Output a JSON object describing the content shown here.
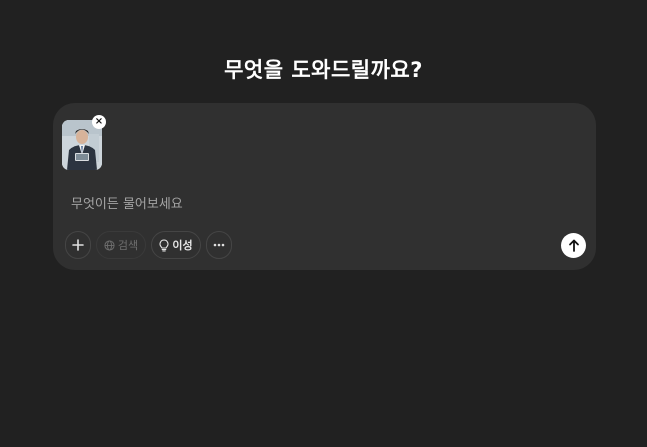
{
  "heading": "무엇을 도와드릴까요?",
  "composer": {
    "placeholder": "무엇이든 물어보세요",
    "attachment": {
      "remove_label": "×"
    },
    "tools": {
      "plus_icon": "plus-icon",
      "search_label": "검색",
      "search_icon": "globe-icon",
      "reason_label": "이성",
      "reason_icon": "lightbulb-icon",
      "more_icon": "ellipsis-icon"
    },
    "send_icon": "arrow-up-icon"
  },
  "colors": {
    "background": "#212121",
    "composer": "#303030",
    "send_button": "#ffffff"
  }
}
